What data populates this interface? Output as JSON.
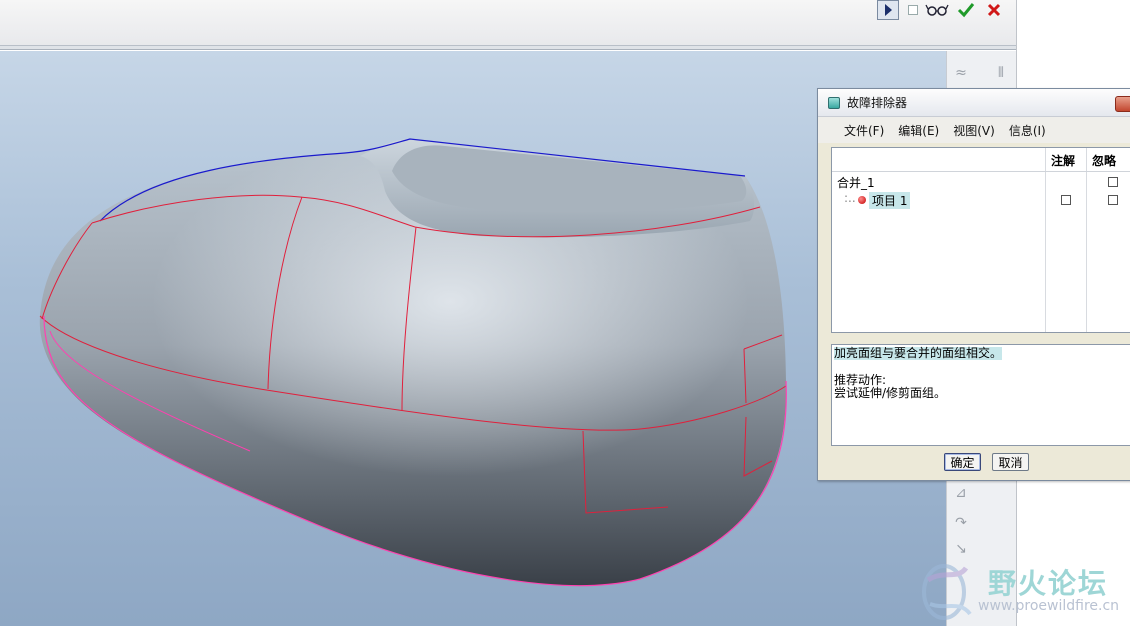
{
  "toolbar": {
    "icons": [
      "pause-icon",
      "checkbox-icon",
      "glasses-icon",
      "checkmark-icon",
      "close-icon"
    ]
  },
  "dialog": {
    "title": "故障排除器",
    "menu": [
      "文件(F)",
      "编辑(E)",
      "视图(V)",
      "信息(I)"
    ],
    "columns": {
      "notes": "注解",
      "ignore": "忽略"
    },
    "tree": {
      "root": "合并_1",
      "child": "项目 1"
    },
    "message": {
      "line1": "加亮面组与要合并的面组相交。",
      "line2": "推荐动作:",
      "line3": "尝试延伸/修剪面组。"
    },
    "buttons": {
      "ok": "确定",
      "cancel": "取消"
    }
  },
  "watermark": {
    "title": "野火论坛",
    "url": "www.proewildfire.cn"
  },
  "colors": {
    "viewport_top": "#c6d6e7",
    "viewport_bottom": "#8ea7c4",
    "edge_red": "#e0203c",
    "edge_magenta": "#ff40b0",
    "edge_blue": "#1a1acc"
  }
}
